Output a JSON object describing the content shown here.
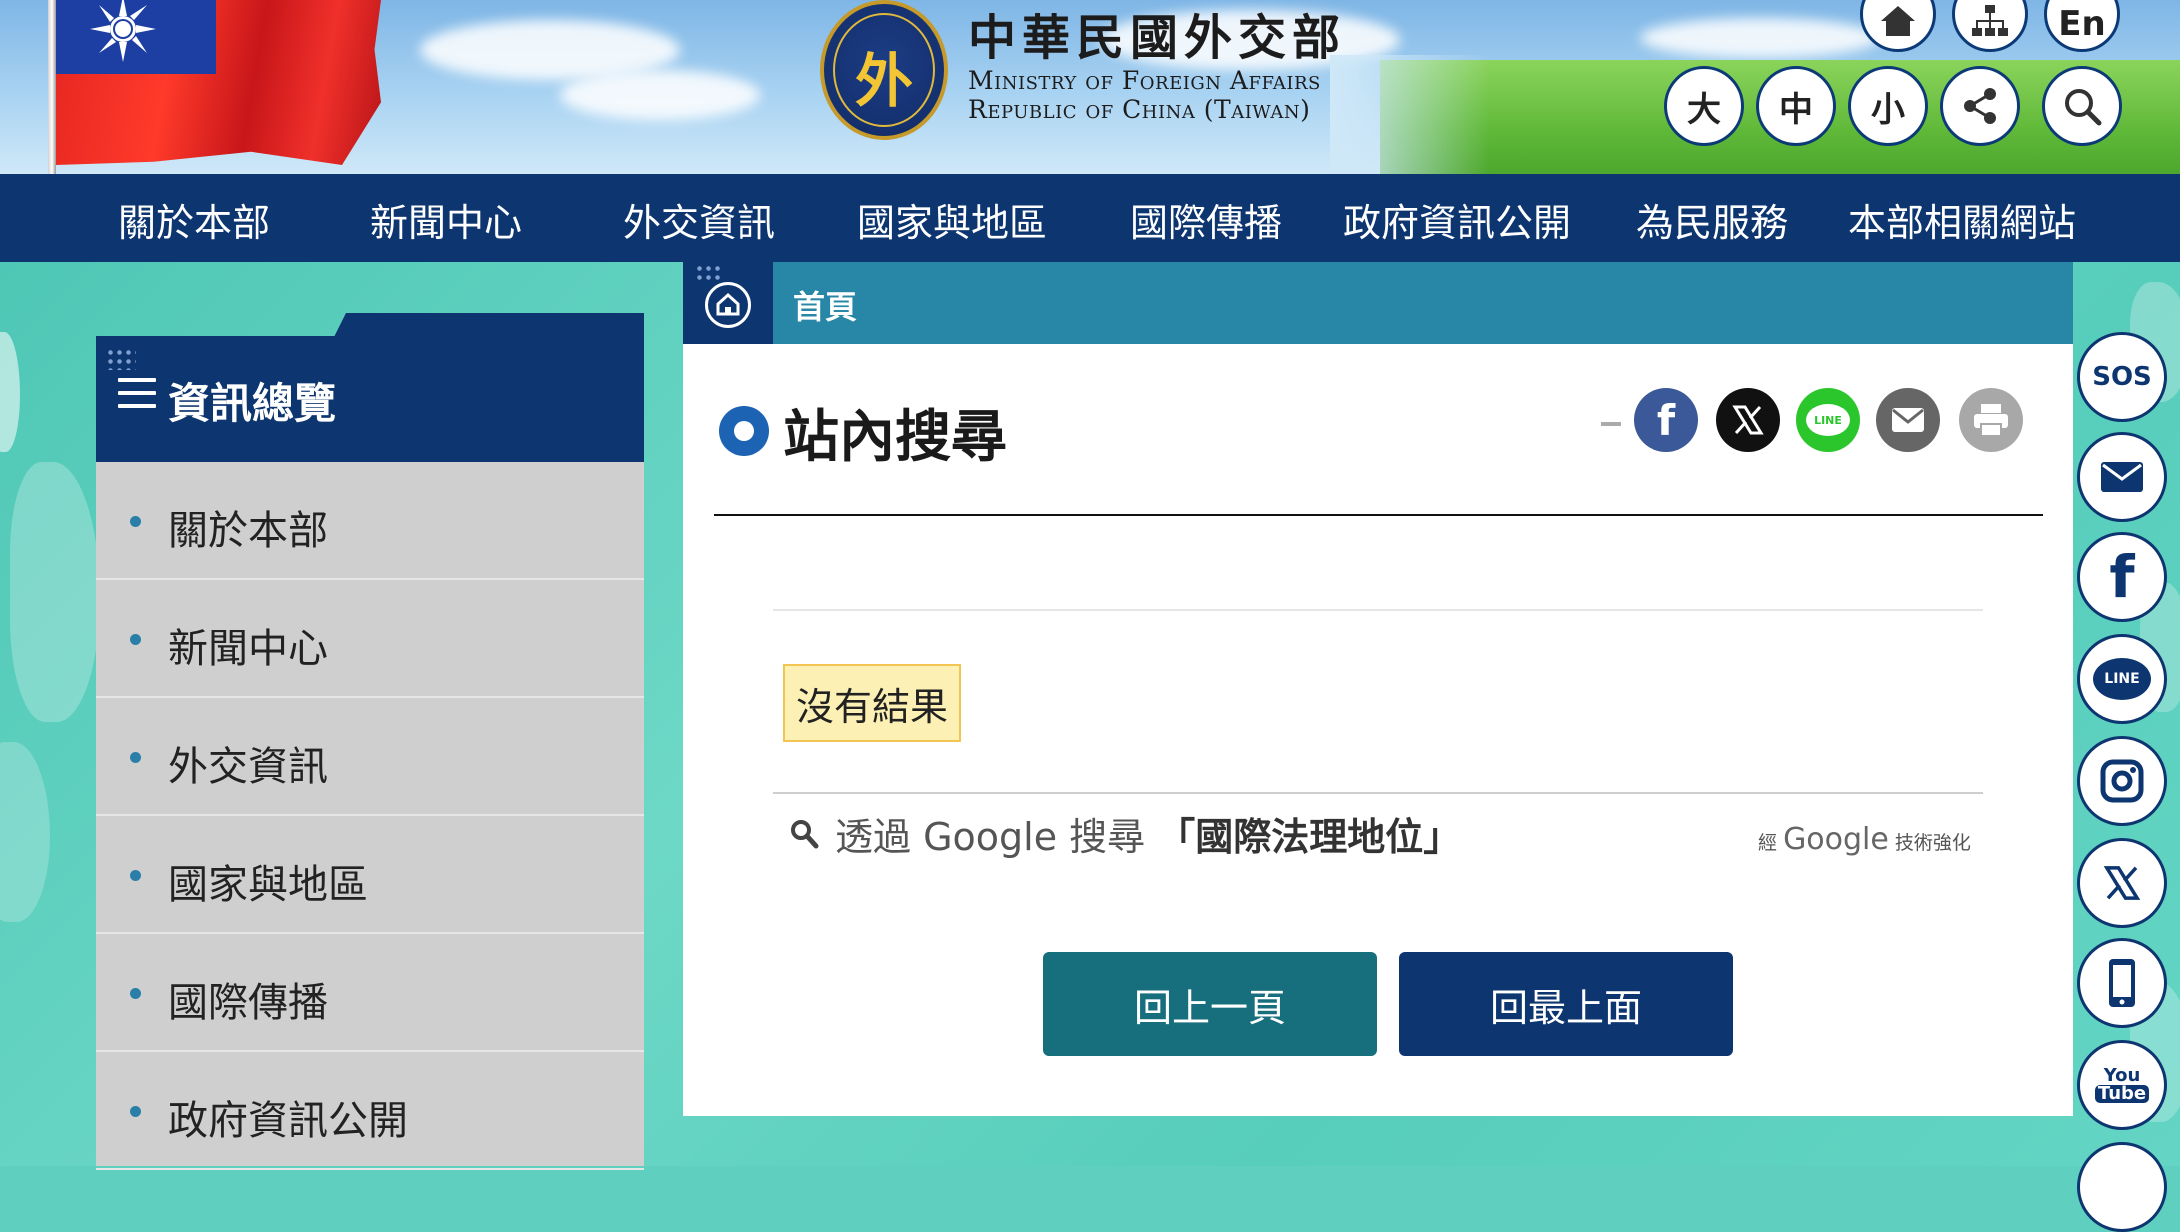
{
  "header": {
    "logo_zh": "中華民國外交部",
    "logo_glyph": "外",
    "logo_en_line1": "Ministry of Foreign Affairs",
    "logo_en_line2": "Republic of China (Taiwan)",
    "top_icons": [
      "home-icon",
      "sitemap-icon"
    ],
    "lang_label": "En",
    "font_size_large": "大",
    "font_size_medium": "中",
    "font_size_small": "小",
    "utility_icons": [
      "share-icon",
      "search-icon"
    ]
  },
  "nav": {
    "items": [
      "關於本部",
      "新聞中心",
      "外交資訊",
      "國家與地區",
      "國際傳播",
      "政府資訊公開",
      "為民服務",
      "本部相關網站"
    ]
  },
  "sidebar": {
    "title": "資訊總覽",
    "items": [
      "關於本部",
      "新聞中心",
      "外交資訊",
      "國家與地區",
      "國際傳播",
      "政府資訊公開"
    ]
  },
  "breadcrumb": {
    "home_label": "首頁"
  },
  "main": {
    "title": "站內搜尋",
    "share_icons": [
      "facebook-icon",
      "x-icon",
      "line-icon",
      "email-icon",
      "print-icon"
    ],
    "no_result": "沒有結果",
    "google_search_prefix": "透過 Google 搜尋",
    "google_search_query": "「國際法理地位」",
    "powered_by_prefix": "經",
    "powered_by_brand": "Google",
    "powered_by_suffix": "技術強化",
    "back_button": "回上一頁",
    "top_button": "回最上面"
  },
  "floating": {
    "items": [
      "SOS",
      "mail-icon",
      "facebook-icon",
      "line-icon",
      "instagram-icon",
      "x-icon",
      "mobile-icon",
      "youtube-icon"
    ],
    "sos_label": "SOS",
    "line_label": "LINE",
    "youtube_label_1": "You",
    "youtube_label_2": "Tube"
  },
  "colors": {
    "navy": "#0d3570",
    "teal_bar": "#2887a6",
    "teal_button": "#176e7c",
    "background": "#5fcfbf",
    "facebook": "#3b5998",
    "line": "#2bc62b",
    "mail": "#666666",
    "print": "#a8a8a8"
  }
}
